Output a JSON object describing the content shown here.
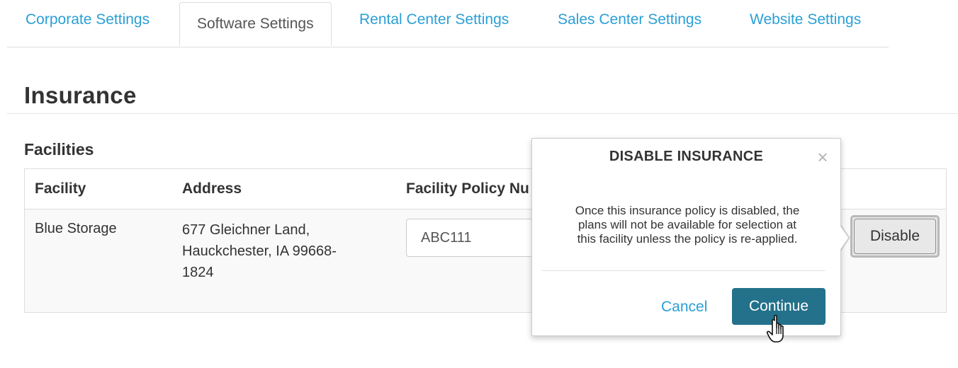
{
  "tabs": [
    {
      "label": "Corporate Settings",
      "active": false
    },
    {
      "label": "Software Settings",
      "active": true
    },
    {
      "label": "Rental Center Settings",
      "active": false
    },
    {
      "label": "Sales Center Settings",
      "active": false
    },
    {
      "label": "Website Settings",
      "active": false
    }
  ],
  "section_title": "Insurance",
  "subsection_title": "Facilities",
  "table": {
    "headers": [
      "Facility",
      "Address",
      "Facility Policy Nu"
    ],
    "rows": [
      {
        "facility": "Blue Storage",
        "address_lines": [
          "677 Gleichner Land,",
          "Hauckchester, IA 99668-",
          "1824"
        ],
        "policy_number": "ABC111",
        "action_label": "Disable"
      }
    ]
  },
  "popover": {
    "title": "DISABLE INSURANCE",
    "close_symbol": "×",
    "body_lines": [
      "Once this insurance policy is disabled, the",
      "plans will not be available for selection at",
      "this facility unless the policy is re-applied."
    ],
    "cancel_label": "Cancel",
    "continue_label": "Continue"
  },
  "colors": {
    "link": "#2a9fd6",
    "primary_button": "#23718a",
    "text": "#333333",
    "border": "#dddddd",
    "row_background": "#f9f9f9"
  },
  "icons": {
    "close": "close-icon",
    "cursor": "hand-cursor-icon"
  }
}
